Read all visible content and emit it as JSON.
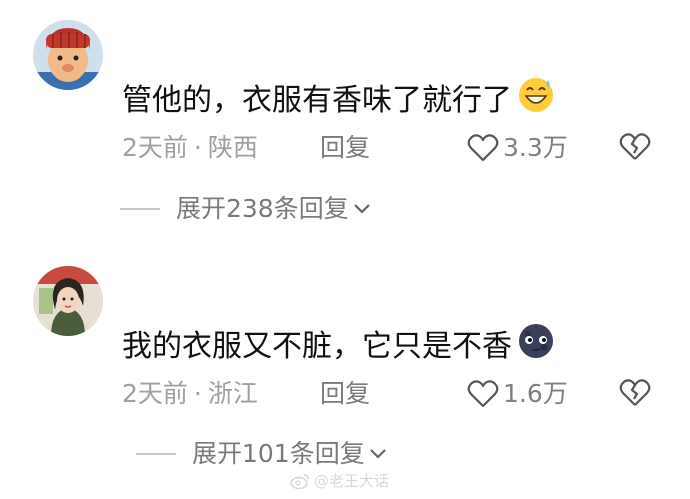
{
  "comments": [
    {
      "text": "管他的，衣服有香味了就行了",
      "emoji_icon": "grinning-sweat-emoji",
      "time": "2天前",
      "location": "陕西",
      "reply_label": "回复",
      "likes": "3.3万",
      "expand_label": "展开238条回复"
    },
    {
      "text": "我的衣服又不脏，它只是不香",
      "emoji_icon": "new-moon-face-emoji",
      "time": "2天前",
      "location": "浙江",
      "reply_label": "回复",
      "likes": "1.6万",
      "expand_label": "展开101条回复"
    }
  ],
  "separator": "·",
  "watermark": {
    "text": "@老王大话"
  },
  "colors": {
    "text": "#111111",
    "meta": "#a0a0a0",
    "secondary": "#7a7a7a",
    "emoji_yellow": "#ffcb3b",
    "moon": "#3a3f5c"
  }
}
